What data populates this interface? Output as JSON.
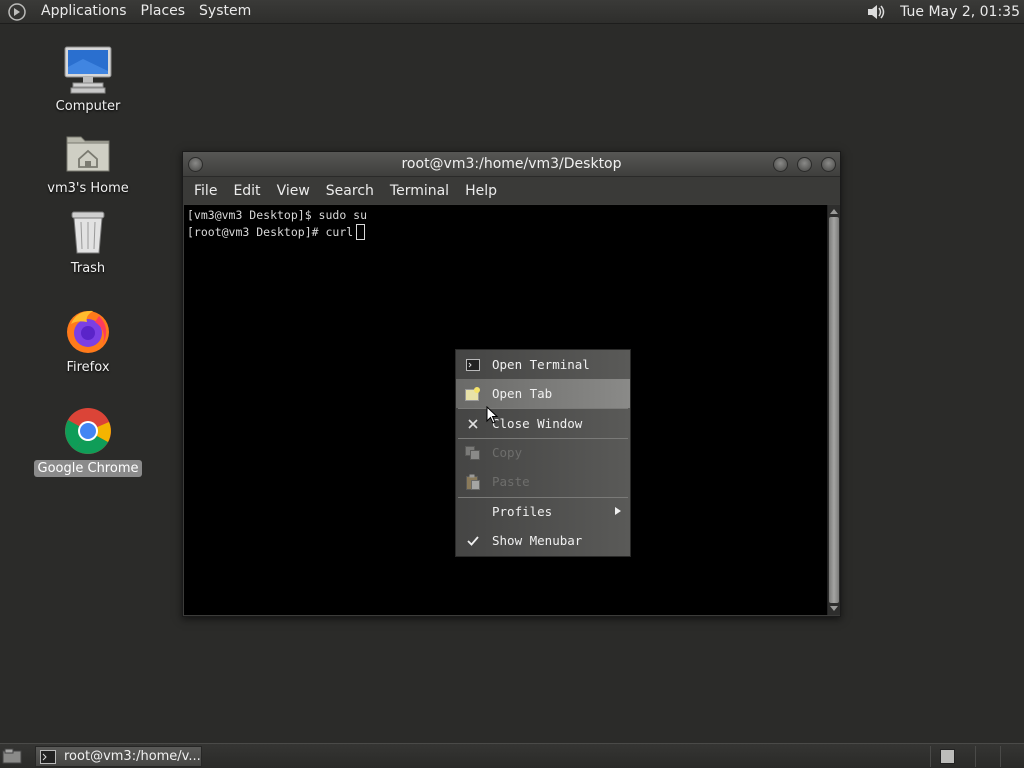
{
  "top_panel": {
    "menus": [
      "Applications",
      "Places",
      "System"
    ],
    "clock": "Tue May  2, 01:35"
  },
  "desktop": {
    "icons": [
      {
        "label": "Computer",
        "icon": "computer-icon"
      },
      {
        "label": "vm3's Home",
        "icon": "home-folder-icon"
      },
      {
        "label": "Trash",
        "icon": "trash-icon"
      },
      {
        "label": "Firefox",
        "icon": "firefox-icon"
      },
      {
        "label": "Google Chrome",
        "icon": "chrome-icon",
        "selected": true
      }
    ]
  },
  "terminal": {
    "title": "root@vm3:/home/vm3/Desktop",
    "menubar": [
      "File",
      "Edit",
      "View",
      "Search",
      "Terminal",
      "Help"
    ],
    "lines": [
      "[vm3@vm3 Desktop]$ sudo su",
      "[root@vm3 Desktop]# curl"
    ]
  },
  "context_menu": {
    "items": [
      {
        "label": "Open Terminal",
        "icon": "terminal-icon",
        "enabled": true
      },
      {
        "label": "Open Tab",
        "icon": "new-tab-icon",
        "enabled": true,
        "hover": true
      },
      {
        "label": "Close Window",
        "icon": "close-icon",
        "enabled": true
      },
      {
        "label": "Copy",
        "icon": "copy-icon",
        "enabled": false
      },
      {
        "label": "Paste",
        "icon": "paste-icon",
        "enabled": false
      },
      {
        "label": "Profiles",
        "icon": "",
        "enabled": true,
        "submenu": true
      },
      {
        "label": "Show Menubar",
        "icon": "checkmark-icon",
        "enabled": true,
        "checked": true
      }
    ]
  },
  "bottom_panel": {
    "task_label": "root@vm3:/home/v..."
  },
  "colors": {
    "desktop_bg": "#2b2b29",
    "terminal_bg": "#000000",
    "selected_label_bg": "#8b8b8b"
  }
}
